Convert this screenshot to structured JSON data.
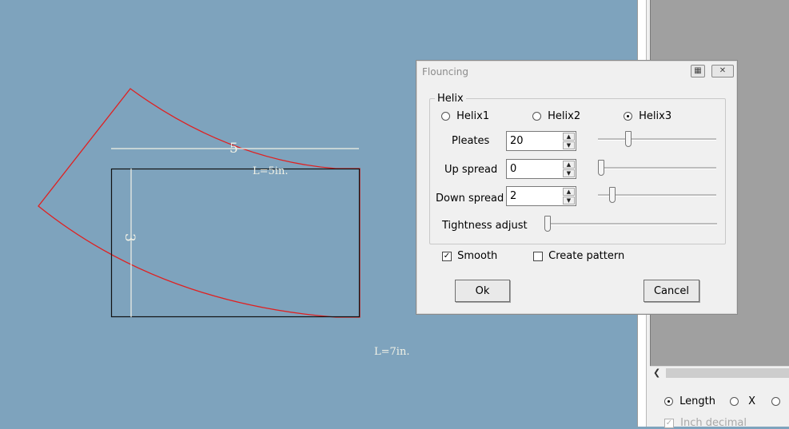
{
  "drawing": {
    "top_dimension": "5",
    "side_dimension": "3",
    "inner_length_label": "L=5in.",
    "outer_length_label": "L=7in.",
    "colors": {
      "background": "#7ea3bd",
      "flounce": "#e02020",
      "rectangle": "#111111",
      "dimension_line": "#f2f2e6"
    }
  },
  "dialog": {
    "title": "Flouncing",
    "calculator_icon": "calculator-icon",
    "close_icon": "close-icon",
    "group_label": "Helix",
    "helix_options": [
      {
        "label": "Helix1",
        "selected": false
      },
      {
        "label": "Helix2",
        "selected": false
      },
      {
        "label": "Helix3",
        "selected": true
      }
    ],
    "pleates": {
      "label": "Pleates",
      "value": "20",
      "slider_fraction": 0.24
    },
    "up_spread": {
      "label": "Up spread",
      "value": "0",
      "slider_fraction": 0.0
    },
    "down_spread": {
      "label": "Down spread",
      "value": "2",
      "slider_fraction": 0.1
    },
    "tightness": {
      "label": "Tightness adjust",
      "slider_fraction": 0.0
    },
    "smooth": {
      "label": "Smooth",
      "checked": true
    },
    "create_pattern": {
      "label": "Create pattern",
      "checked": false
    },
    "ok_label": "Ok",
    "cancel_label": "Cancel"
  },
  "side_panel": {
    "units": [
      {
        "label": "Length",
        "selected": true
      },
      {
        "label": "X",
        "selected": false
      },
      {
        "label": "",
        "selected": false
      }
    ],
    "inch_decimal": {
      "label": "Inch decimal",
      "checked": true,
      "disabled": true
    }
  }
}
